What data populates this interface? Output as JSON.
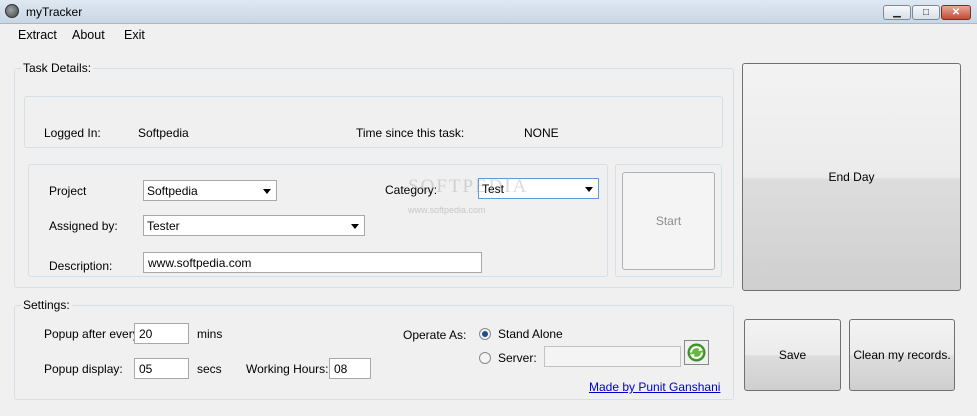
{
  "window": {
    "title": "myTracker"
  },
  "menu": {
    "items": [
      "Extract",
      "About",
      "Exit"
    ]
  },
  "task_details": {
    "legend": "Task Details:",
    "logged_in_label": "Logged In:",
    "logged_in_value": "Softpedia",
    "time_since_label": "Time since this task:",
    "time_since_value": "NONE",
    "project_label": "Project",
    "project_value": "Softpedia",
    "category_label": "Category:",
    "category_value": "Test",
    "assigned_by_label": "Assigned by:",
    "assigned_by_value": "Tester",
    "description_label": "Description:",
    "description_value": "www.softpedia.com",
    "start_label": "Start"
  },
  "end_day_label": "End Day",
  "settings": {
    "legend": "Settings:",
    "popup_every_label": "Popup after every:",
    "popup_every_value": "20",
    "popup_every_unit": "mins",
    "popup_display_label": "Popup display:",
    "popup_display_value": "05",
    "popup_display_unit": "secs",
    "working_hours_label": "Working Hours:",
    "working_hours_value": "08",
    "operate_as_label": "Operate As:",
    "standalone_label": "Stand Alone",
    "server_label": "Server:",
    "server_value": "",
    "made_by_link": "Made by Punit Ganshani"
  },
  "buttons": {
    "save": "Save",
    "clean": "Clean my records."
  },
  "watermark": {
    "main": "SOFTPEDIA",
    "sub": "www.softpedia.com"
  }
}
